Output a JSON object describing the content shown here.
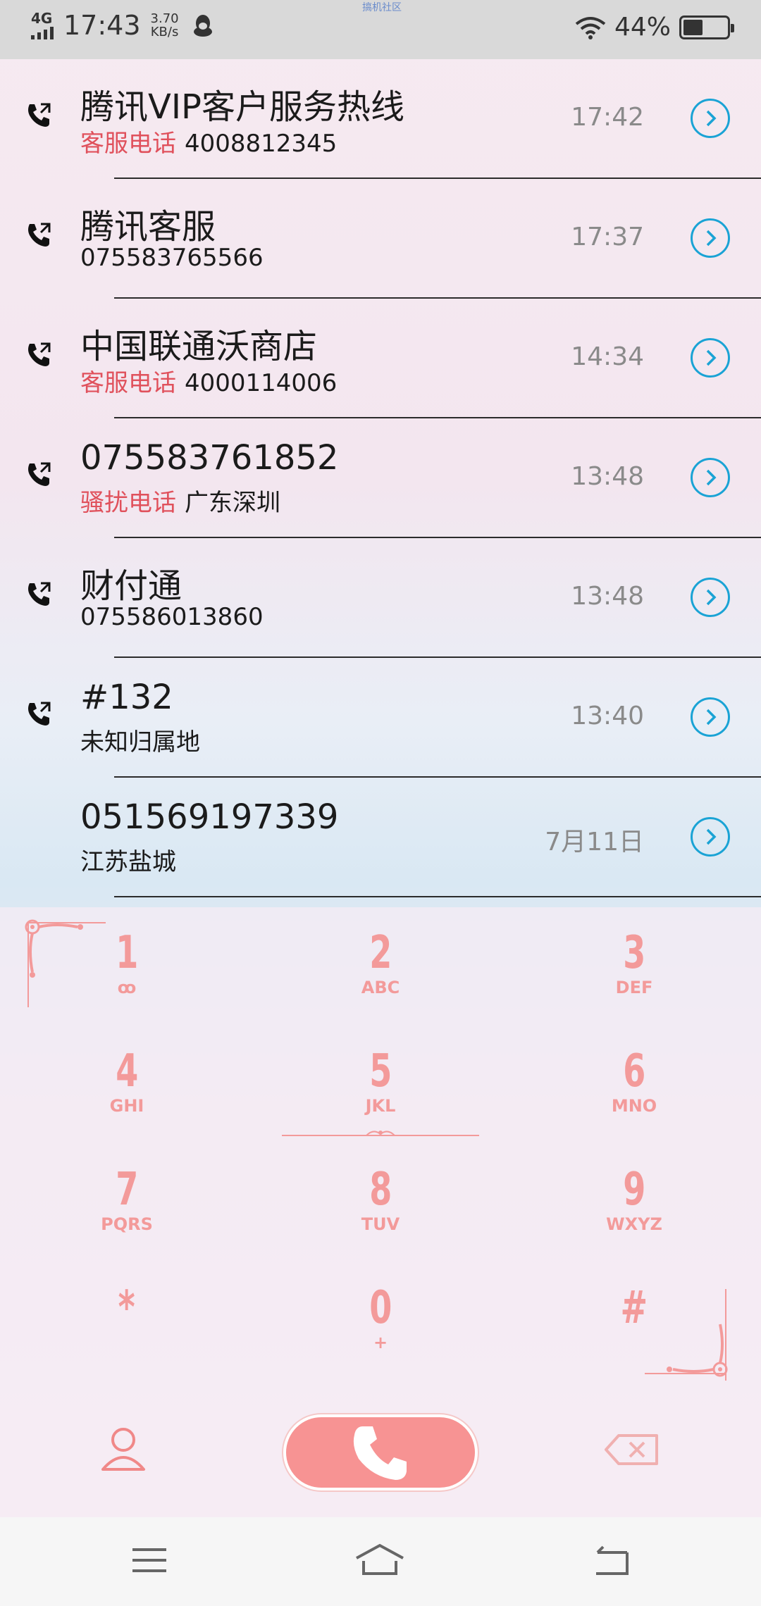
{
  "status_bar": {
    "network": "4G",
    "time": "17:43",
    "speed_value": "3.70",
    "speed_unit": "KB/s",
    "center_text": "搞机社区",
    "battery_percent": "44%",
    "battery_level": 0.44
  },
  "calls": [
    {
      "name": "腾讯VIP客户服务热线",
      "tag": "客服电话",
      "detail": "4008812345",
      "time": "17:42",
      "has_icon": true
    },
    {
      "name": "腾讯客服",
      "tag": "",
      "detail": "075583765566",
      "time": "17:37",
      "has_icon": true
    },
    {
      "name": "中国联通沃商店",
      "tag": "客服电话",
      "detail": "4000114006",
      "time": "14:34",
      "has_icon": true
    },
    {
      "name": "075583761852",
      "tag": "骚扰电话",
      "detail": "广东深圳",
      "time": "13:48",
      "has_icon": true
    },
    {
      "name": "财付通",
      "tag": "",
      "detail": "075586013860",
      "time": "13:48",
      "has_icon": true
    },
    {
      "name": "#132",
      "tag": "",
      "detail": "未知归属地",
      "time": "13:40",
      "has_icon": true
    },
    {
      "name": "051569197339",
      "tag": "",
      "detail": "江苏盐城",
      "time": "7月11日",
      "has_icon": false
    }
  ],
  "dialpad": {
    "keys": [
      {
        "digit": "1",
        "letters": "ꝏ"
      },
      {
        "digit": "2",
        "letters": "ABC"
      },
      {
        "digit": "3",
        "letters": "DEF"
      },
      {
        "digit": "4",
        "letters": "GHI"
      },
      {
        "digit": "5",
        "letters": "JKL"
      },
      {
        "digit": "6",
        "letters": "MNO"
      },
      {
        "digit": "7",
        "letters": "PQRS"
      },
      {
        "digit": "8",
        "letters": "TUV"
      },
      {
        "digit": "9",
        "letters": "WXYZ"
      },
      {
        "digit": "*",
        "letters": ""
      },
      {
        "digit": "0",
        "letters": "+"
      },
      {
        "digit": "#",
        "letters": ""
      }
    ]
  },
  "icons": {
    "contacts": "person-icon",
    "call": "phone-icon",
    "delete": "backspace-icon",
    "menu": "menu-icon",
    "home": "home-icon",
    "back": "back-icon"
  },
  "colors": {
    "accent_pink": "#f79393",
    "tag_red": "#e0515c",
    "detail_blue": "#1aa3d5"
  }
}
